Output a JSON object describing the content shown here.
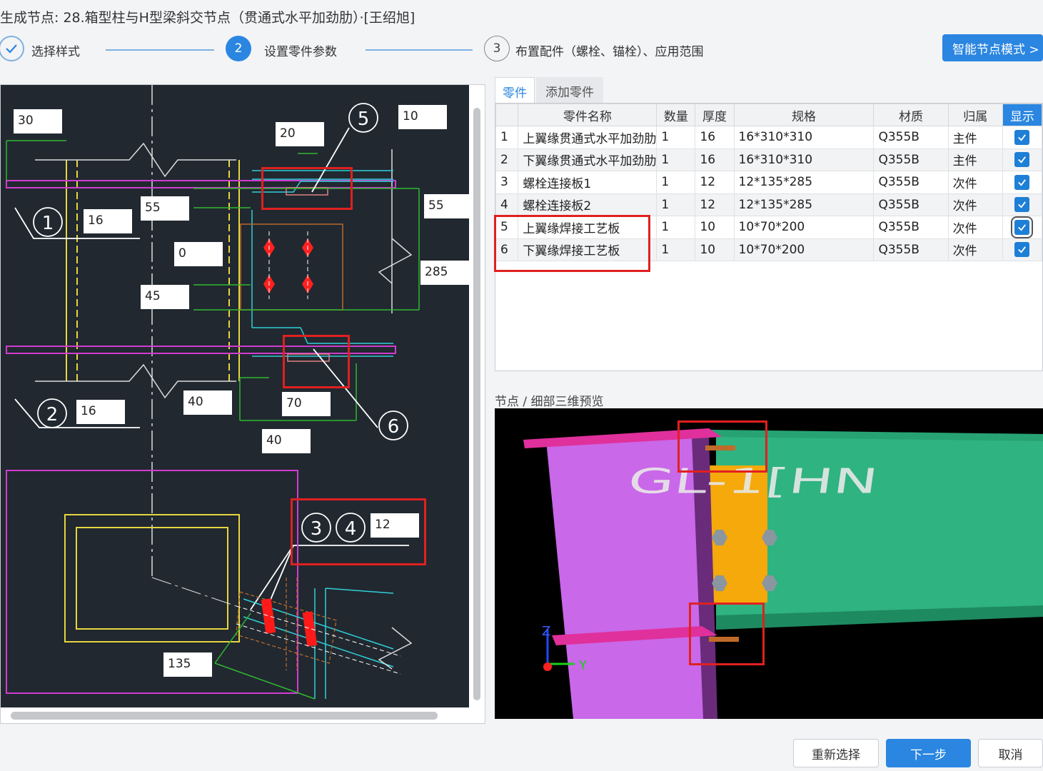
{
  "window": {
    "title": "生成节点: 28.箱型柱与H型梁斜交节点（贯通式水平加劲肋）·[王绍旭]"
  },
  "steps": [
    {
      "number": "",
      "label": "选择样式",
      "state": "done"
    },
    {
      "number": "2",
      "label": "设置零件参数",
      "state": "active"
    },
    {
      "number": "3",
      "label": "布置配件（螺栓、锚栓）、应用范围",
      "state": "pending"
    }
  ],
  "smart_mode_button": "智能节点模式 >",
  "cad": {
    "dims": [
      "30",
      "20",
      "10",
      "55",
      "16",
      "55",
      "0",
      "45",
      "285",
      "40",
      "70",
      "16",
      "40",
      "12",
      "135"
    ],
    "callouts": [
      "1",
      "2",
      "3",
      "4",
      "5",
      "6"
    ]
  },
  "tabs": [
    {
      "label": "零件",
      "active": true
    },
    {
      "label": "添加零件",
      "active": false
    }
  ],
  "parts_table": {
    "columns": [
      "",
      "零件名称",
      "数量",
      "厚度",
      "规格",
      "材质",
      "归属",
      "显示"
    ],
    "rows": [
      {
        "no": "1",
        "name": "上翼缘贯通式水平加劲肋",
        "qty": "1",
        "thickness": "16",
        "spec": "16*310*310",
        "material": "Q355B",
        "owner": "主件",
        "show": true
      },
      {
        "no": "2",
        "name": "下翼缘贯通式水平加劲肋",
        "qty": "1",
        "thickness": "16",
        "spec": "16*310*310",
        "material": "Q355B",
        "owner": "主件",
        "show": true
      },
      {
        "no": "3",
        "name": "螺栓连接板1",
        "qty": "1",
        "thickness": "12",
        "spec": "12*135*285",
        "material": "Q355B",
        "owner": "次件",
        "show": true
      },
      {
        "no": "4",
        "name": "螺栓连接板2",
        "qty": "1",
        "thickness": "12",
        "spec": "12*135*285",
        "material": "Q355B",
        "owner": "次件",
        "show": true
      },
      {
        "no": "5",
        "name": "上翼缘焊接工艺板",
        "qty": "1",
        "thickness": "10",
        "spec": "10*70*200",
        "material": "Q355B",
        "owner": "次件",
        "show": true
      },
      {
        "no": "6",
        "name": "下翼缘焊接工艺板",
        "qty": "1",
        "thickness": "10",
        "spec": "10*70*200",
        "material": "Q355B",
        "owner": "次件",
        "show": true
      }
    ]
  },
  "preview": {
    "label": "节点 / 细部三维预览",
    "beam_text": "GL-1[HN",
    "axis_z": "Z",
    "axis_y": "Y"
  },
  "buttons": {
    "reselect": "重新选择",
    "next": "下一步",
    "cancel": "取消"
  }
}
